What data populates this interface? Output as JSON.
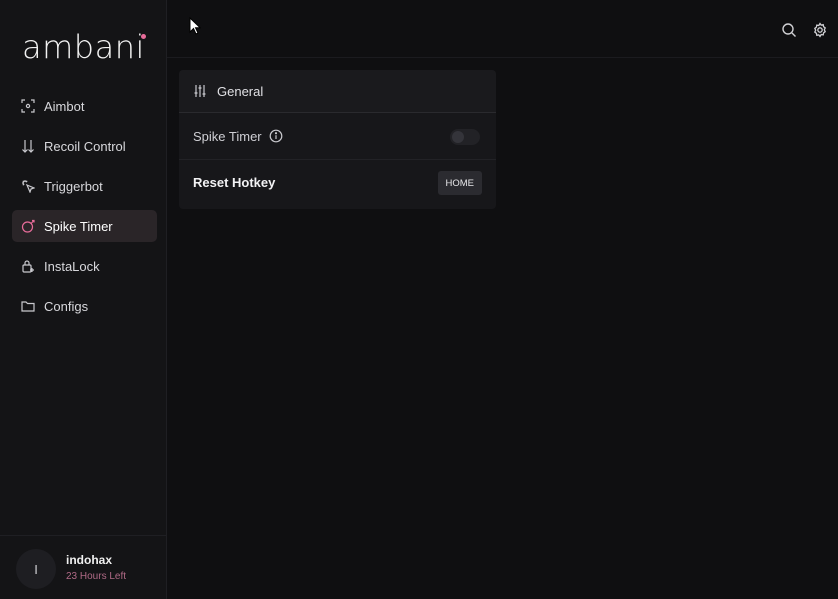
{
  "app": {
    "logo_text": "ambani",
    "accent": "#e86c9a"
  },
  "sidebar": {
    "items": [
      {
        "label": "Aimbot",
        "icon": "crosshair-focus-icon"
      },
      {
        "label": "Recoil Control",
        "icon": "arrows-down-icon"
      },
      {
        "label": "Triggerbot",
        "icon": "pointer-click-icon"
      },
      {
        "label": "Spike Timer",
        "icon": "spike-icon",
        "active": true
      },
      {
        "label": "InstaLock",
        "icon": "lock-icon"
      },
      {
        "label": "Configs",
        "icon": "folder-icon"
      }
    ]
  },
  "user": {
    "initial": "I",
    "name": "indohax",
    "status": "23 Hours Left"
  },
  "topbar": {
    "icons": [
      "search-icon",
      "gear-icon"
    ]
  },
  "card": {
    "header": {
      "label": "General",
      "icon": "sliders-icon"
    },
    "rows": [
      {
        "label": "Spike Timer",
        "control": "toggle",
        "on": false,
        "icon": "info-icon"
      },
      {
        "label": "Reset Hotkey",
        "control": "hotkey",
        "value": "HOME"
      }
    ]
  }
}
